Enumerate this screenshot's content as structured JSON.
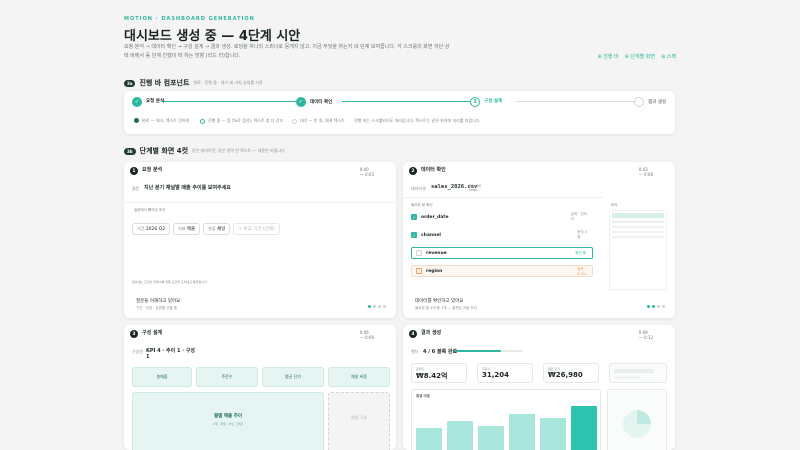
{
  "header": {
    "eyebrow": "MOTION · DASHBOARD GENERATION",
    "title": "대시보드 생성 중 — 4단계 시안",
    "desc": "요청 분석 → 데이터 확인 → 구성 설계 → 결과 생성. 로딩을 하나의 스피너로 뭉개지 않고, 지금 무엇을 하는지 네 단계 보여줍니다. 각 스크롤의 화면 하단 상태 바에서 동 단계 진행이 떠 하는 방향 (리드 리)합니다.",
    "links": [
      "⊕ 진행 바",
      "⊕ 단계별 화면",
      "⊕ 스펙"
    ]
  },
  "section1": {
    "badge": "3a",
    "title": "진행 바 컴포넌트",
    "sub": "완료 · 진행 중 · 대기 세 가지 상태를 사용"
  },
  "stepper": {
    "steps": [
      {
        "label": "요청 분석",
        "state": "done",
        "mark": "✓"
      },
      {
        "label": "데이터 확인",
        "state": "done",
        "mark": "✓"
      },
      {
        "label": "구성 설계",
        "state": "active",
        "mark": "3"
      },
      {
        "label": "결과 생성",
        "state": "todo",
        "mark": ""
      }
    ],
    "legend": [
      {
        "text": "완료 — 체크, 텍스트 진하게"
      },
      {
        "text": "진행 중 — 링 (%로 점선), 텍스트 청 다 강조"
      },
      {
        "text": "대기 — 빈 원, 회색 텍스트"
      }
    ],
    "note": "진행 바는 스크롤되어도 따라갑니다. 텍스트는 같은 위치에 자리를 지킵니다."
  },
  "section2": {
    "badge": "3b",
    "title": "단계별 화면 4컷",
    "sub": "같은 레이아웃, 같은 영역 안 텍스트 — 내용만 바뀝니다"
  },
  "panel1": {
    "num": "1",
    "title": "요청 분석",
    "time": "0:00\n— 0:03",
    "request_label": "질문",
    "request": "지난 분기 채널별 매출 추이를 보여주세요",
    "extract_label": "질문에서 뽑아낸 조건",
    "chips": [
      {
        "k": "기간",
        "v": "2026 Q2"
      },
      {
        "k": "지표",
        "v": "매출"
      },
      {
        "k": "분류",
        "v": "채널"
      },
      {
        "k": "",
        "v": "+ 비교 기간 (선택)"
      }
    ],
    "hint": "뽑아내는 조건이 많을수록 위쪽 조건을 드러내고 통제합니다.",
    "footer": "질문을 이해하고 있어요",
    "footer_sub": "기간 · 지표 · 분류를 추출 중"
  },
  "panel2": {
    "num": "2",
    "title": "데이터 확인",
    "time": "0:03\n— 0:06",
    "file_label": "데이터셋",
    "file": "sales_2026.csv",
    "rows": "12,400\nrows",
    "list_label": "필요한 열 확인",
    "preview_label": "미리",
    "fields": [
      {
        "name": "order_date",
        "state": "ok",
        "note": "날짜 · 전처\n리"
      },
      {
        "name": "channel",
        "state": "ok",
        "note": "문자 4\n종"
      },
      {
        "name": "revenue",
        "state": "checking",
        "note": "확인 중"
      },
      {
        "name": "region",
        "state": "warn",
        "note": "결측\n3.4%"
      }
    ],
    "footer": "데이터를 확인하고 있어요",
    "footer_sub": "필요한 열 4개 중 3개 — 결측은 자동 보간"
  },
  "panel3": {
    "num": "3",
    "title": "구성 설계",
    "time": "0:06\n— 0:09",
    "layout_label": "구성안",
    "layout": "KPI 4 · 추이 1 · 구성 1",
    "kpis": [
      "총매출",
      "주문수",
      "평균 단가",
      "채널 비중"
    ],
    "main_chart": "월별 매출 추이",
    "main_chart_sub": "2개 · 계열 · 라인 그래프",
    "side_chart": "채널 구성"
  },
  "panel4": {
    "num": "4",
    "title": "결과 생성",
    "time": "0:09\n— 0:12",
    "progress_label": "렌더",
    "progress_text": "4 / 6 블록 완료",
    "progress": 0.67,
    "stats": [
      {
        "l": "총매출",
        "v": "₩8.42억"
      },
      {
        "l": "주문수",
        "v": "31,204"
      },
      {
        "l": "평균 단가",
        "v": "₩26,980"
      }
    ],
    "chart_label": "월별 매출",
    "bars": [
      0.45,
      0.6,
      0.5,
      0.75,
      0.66,
      0.92
    ]
  }
}
